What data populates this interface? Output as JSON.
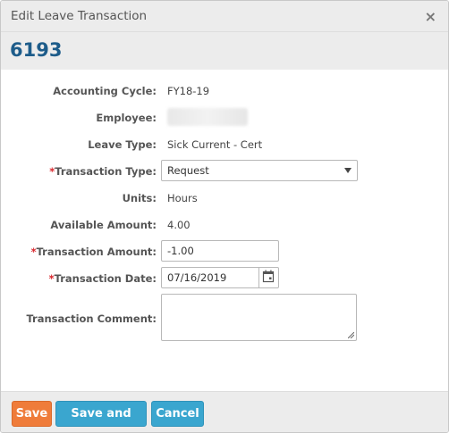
{
  "dialog": {
    "title": "Edit Leave Transaction",
    "close_symbol": "×",
    "record_id": "6193"
  },
  "form": {
    "accounting_cycle": {
      "label": "Accounting Cycle:",
      "value": "FY18-19"
    },
    "employee": {
      "label": "Employee:",
      "value": ""
    },
    "leave_type": {
      "label": "Leave Type:",
      "value": "Sick Current - Cert"
    },
    "transaction_type": {
      "required_mark": "*",
      "label": "Transaction Type:",
      "value": "Request"
    },
    "units": {
      "label": "Units:",
      "value": "Hours"
    },
    "available_amount": {
      "label": "Available Amount:",
      "value": "4.00"
    },
    "transaction_amount": {
      "required_mark": "*",
      "label": "Transaction Amount:",
      "value": "-1.00"
    },
    "transaction_date": {
      "required_mark": "*",
      "label": "Transaction Date:",
      "value": "07/16/2019"
    },
    "transaction_comment": {
      "label": "Transaction Comment:",
      "value": ""
    }
  },
  "footer": {
    "save_label": "Save",
    "save_and_add_label": "Save and Add",
    "cancel_label": "Cancel"
  },
  "icons": {
    "close": "close-icon",
    "dropdown": "chevron-down-icon",
    "calendar": "calendar-icon"
  },
  "colors": {
    "accent_blue": "#3aa6cf",
    "save_orange": "#ef7c3a",
    "title_blue": "#1d5c8a",
    "required_red": "#d9262c"
  }
}
